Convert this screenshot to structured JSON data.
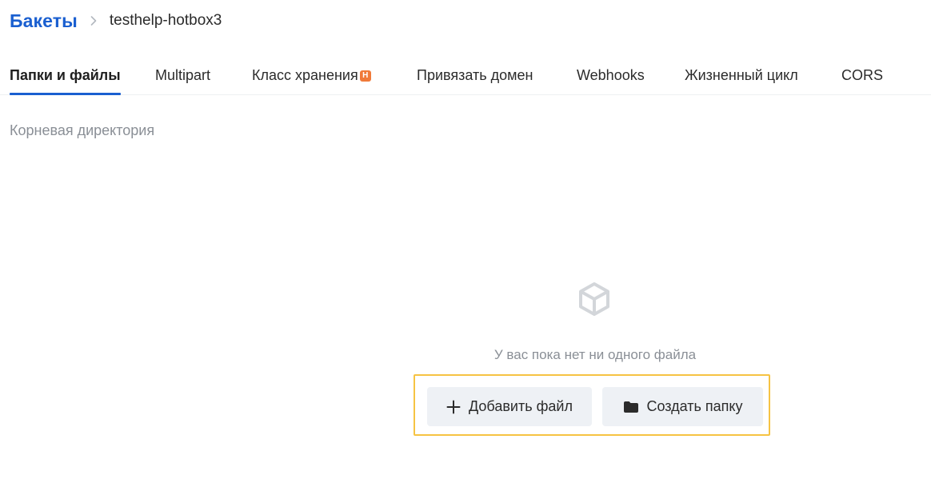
{
  "breadcrumb": {
    "root": "Бакеты",
    "current": "testhelp-hotbox3"
  },
  "tabs": [
    {
      "label": "Папки и файлы",
      "active": true
    },
    {
      "label": "Multipart"
    },
    {
      "label": "Класс хранения",
      "badge": "Н"
    },
    {
      "label": "Привязать домен"
    },
    {
      "label": "Webhooks"
    },
    {
      "label": "Жизненный цикл"
    },
    {
      "label": "CORS"
    }
  ],
  "location": "Корневая директория",
  "empty_state": {
    "icon": "cube-icon",
    "message": "У вас пока нет ни одного файла",
    "add_file_label": "Добавить файл",
    "create_folder_label": "Создать папку"
  },
  "colors": {
    "accent": "#1a5fd0",
    "badge": "#f07a3a",
    "highlight_border": "#f6c343",
    "button_bg": "#eef1f5",
    "muted_text": "#8a8f96"
  }
}
